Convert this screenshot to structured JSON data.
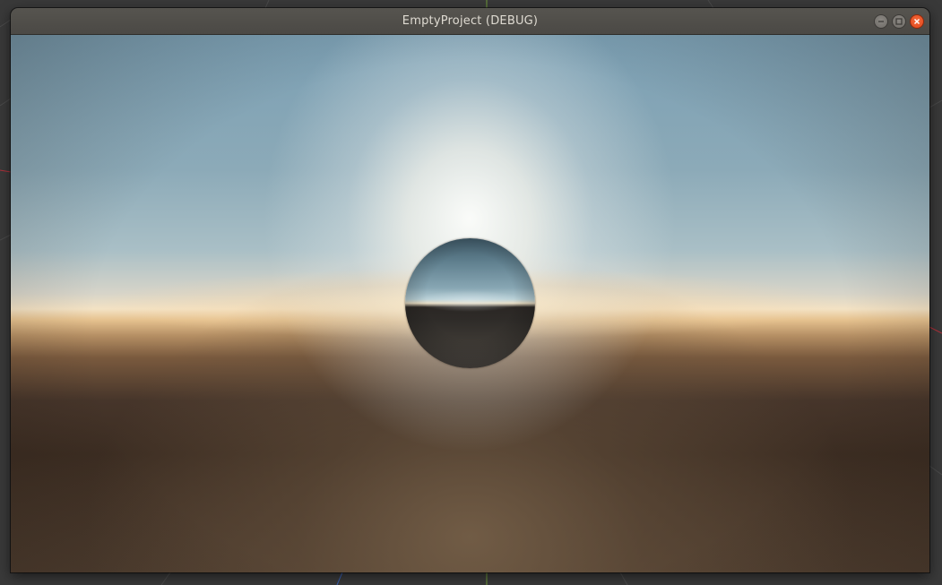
{
  "window": {
    "title": "EmptyProject (DEBUG)",
    "controls": {
      "minimize_icon": "minimize-icon",
      "maximize_icon": "maximize-icon",
      "close_icon": "close-icon"
    }
  },
  "viewport": {
    "scene": "skybox-with-reflective-sphere"
  },
  "colors": {
    "titlebar": "#4f4d49",
    "title_text": "#dfdbd2",
    "close_button": "#e95420",
    "sky_top": "#7b9fb3",
    "horizon": "#f3e2c4",
    "ground": "#3c2d22"
  }
}
